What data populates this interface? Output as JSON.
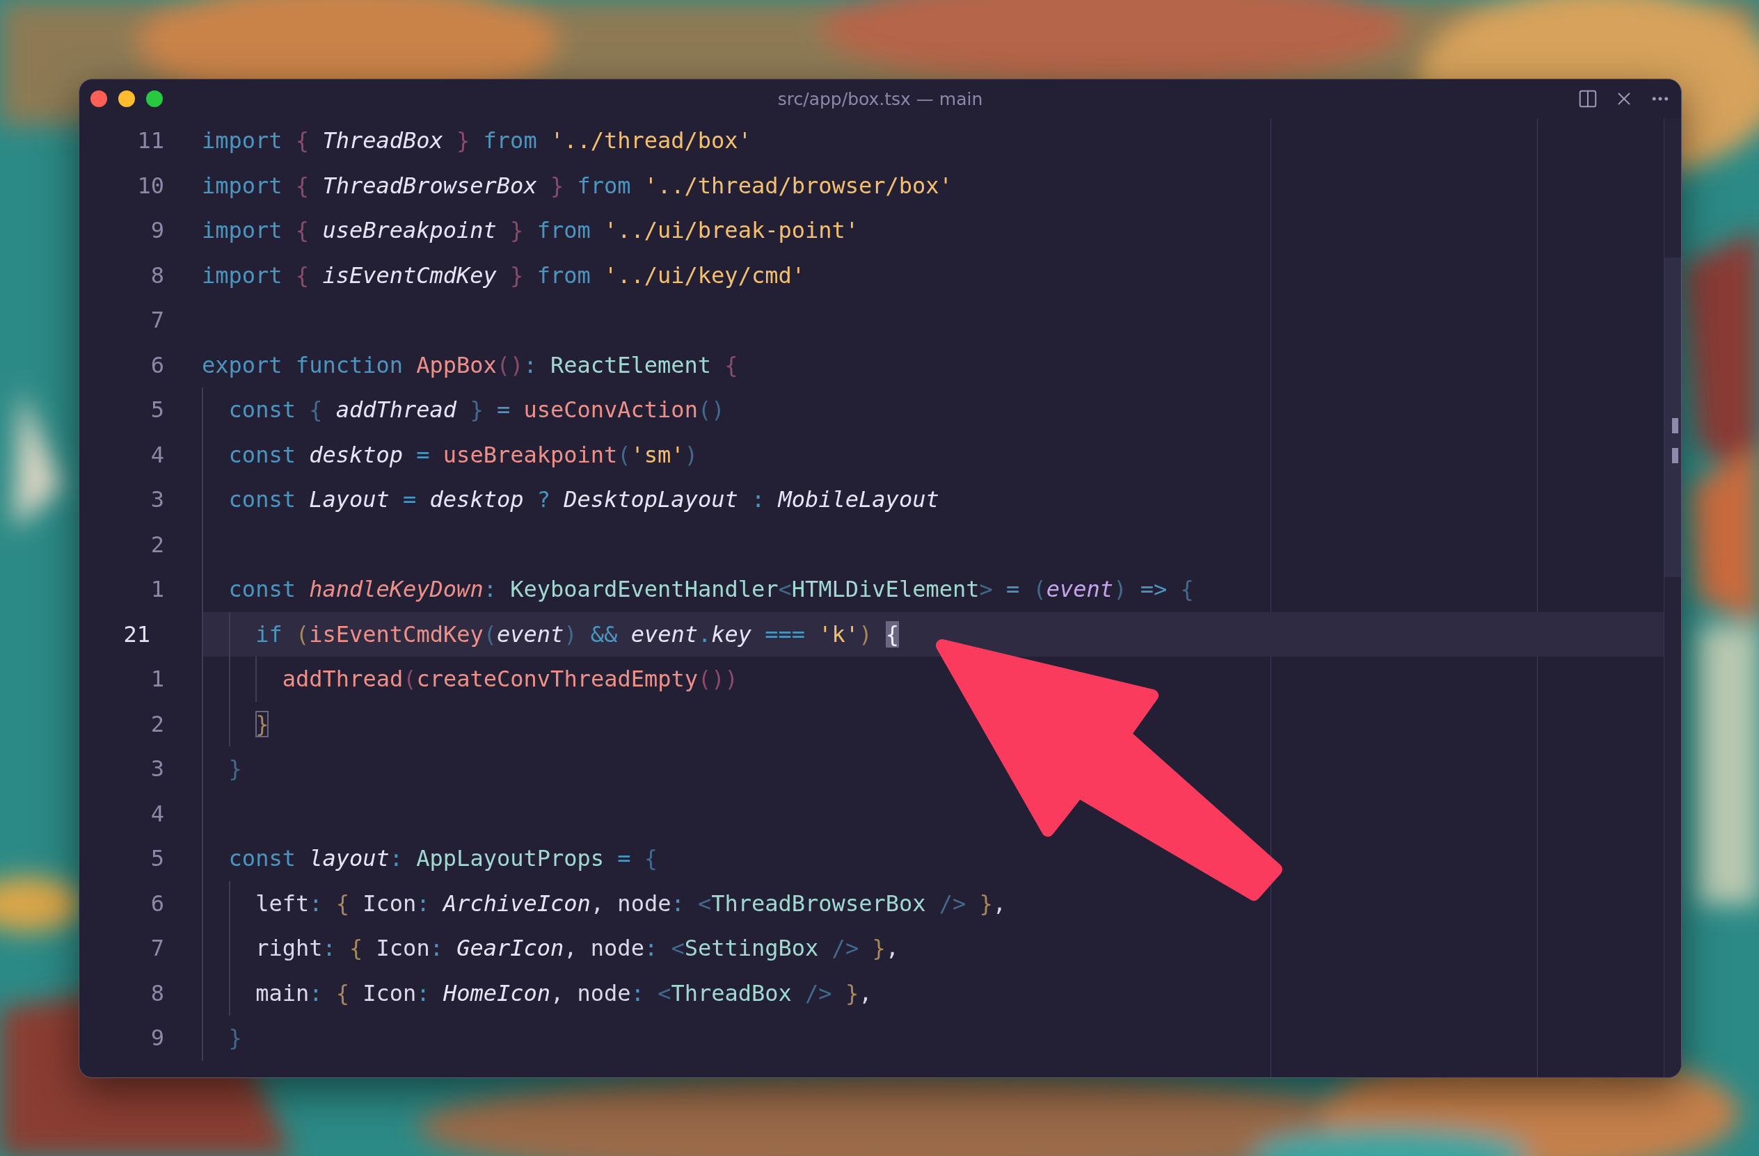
{
  "window": {
    "title": "src/app/box.tsx — main"
  },
  "editor": {
    "lines": [
      {
        "number": "11",
        "current": false,
        "bracket_match": false,
        "tokens": [
          {
            "text": "import ",
            "kind": "keyword"
          },
          {
            "text": "{ ",
            "kind": "bracket1"
          },
          {
            "text": "ThreadBox ",
            "kind": "italic"
          },
          {
            "text": "} ",
            "kind": "bracket1"
          },
          {
            "text": "from ",
            "kind": "keyword"
          },
          {
            "text": "'../thread/box'",
            "kind": "string"
          }
        ]
      },
      {
        "number": "10",
        "current": false,
        "bracket_match": false,
        "tokens": [
          {
            "text": "import ",
            "kind": "keyword"
          },
          {
            "text": "{ ",
            "kind": "bracket1"
          },
          {
            "text": "ThreadBrowserBox ",
            "kind": "italic"
          },
          {
            "text": "} ",
            "kind": "bracket1"
          },
          {
            "text": "from ",
            "kind": "keyword"
          },
          {
            "text": "'../thread/browser/box'",
            "kind": "string"
          }
        ]
      },
      {
        "number": "9",
        "current": false,
        "bracket_match": false,
        "tokens": [
          {
            "text": "import ",
            "kind": "keyword"
          },
          {
            "text": "{ ",
            "kind": "bracket1"
          },
          {
            "text": "useBreakpoint ",
            "kind": "italic"
          },
          {
            "text": "} ",
            "kind": "bracket1"
          },
          {
            "text": "from ",
            "kind": "keyword"
          },
          {
            "text": "'../ui/break-point'",
            "kind": "string"
          }
        ]
      },
      {
        "number": "8",
        "current": false,
        "bracket_match": false,
        "tokens": [
          {
            "text": "import ",
            "kind": "keyword"
          },
          {
            "text": "{ ",
            "kind": "bracket1"
          },
          {
            "text": "isEventCmdKey ",
            "kind": "italic"
          },
          {
            "text": "} ",
            "kind": "bracket1"
          },
          {
            "text": "from ",
            "kind": "keyword"
          },
          {
            "text": "'../ui/key/cmd'",
            "kind": "string"
          }
        ]
      },
      {
        "number": "7",
        "current": false
      },
      {
        "number": "6",
        "current": false,
        "bracket_match": false,
        "tokens": [
          {
            "text": "export function ",
            "kind": "keyword"
          },
          {
            "text": "AppBox",
            "kind": "function"
          },
          {
            "text": "()",
            "kind": "bracket1"
          },
          {
            "text": ": ",
            "kind": "operator"
          },
          {
            "text": "ReactElement ",
            "kind": "type"
          },
          {
            "text": "{",
            "kind": "bracket1"
          }
        ],
        "children": [
          {
            "number": "5",
            "current": false,
            "bracket_match": false,
            "tokens": [
              {
                "text": "const ",
                "kind": "keyword"
              },
              {
                "text": "{ ",
                "kind": "bracket2"
              },
              {
                "text": "addThread ",
                "kind": "italic"
              },
              {
                "text": "} ",
                "kind": "bracket2"
              },
              {
                "text": "= ",
                "kind": "operator"
              },
              {
                "text": "useConvAction",
                "kind": "function"
              },
              {
                "text": "()",
                "kind": "bracket2"
              }
            ]
          },
          {
            "number": "4",
            "current": false,
            "bracket_match": false,
            "tokens": [
              {
                "text": "const ",
                "kind": "keyword"
              },
              {
                "text": "desktop ",
                "kind": "italic"
              },
              {
                "text": "= ",
                "kind": "operator"
              },
              {
                "text": "useBreakpoint",
                "kind": "function"
              },
              {
                "text": "(",
                "kind": "bracket2"
              },
              {
                "text": "'sm'",
                "kind": "string"
              },
              {
                "text": ")",
                "kind": "bracket2"
              }
            ]
          },
          {
            "number": "3",
            "current": false,
            "bracket_match": false,
            "tokens": [
              {
                "text": "const ",
                "kind": "keyword"
              },
              {
                "text": "Layout ",
                "kind": "italic"
              },
              {
                "text": "= ",
                "kind": "operator"
              },
              {
                "text": "desktop ",
                "kind": "italic"
              },
              {
                "text": "? ",
                "kind": "operator"
              },
              {
                "text": "DesktopLayout ",
                "kind": "italic"
              },
              {
                "text": ": ",
                "kind": "operator"
              },
              {
                "text": "MobileLayout",
                "kind": "italic"
              }
            ]
          },
          {
            "number": "2",
            "current": false
          },
          {
            "number": "1",
            "current": false,
            "bracket_match": false,
            "tokens": [
              {
                "text": "const ",
                "kind": "keyword"
              },
              {
                "text": "handleKeyDown",
                "kind": "function_italic"
              },
              {
                "text": ": ",
                "kind": "operator"
              },
              {
                "text": "KeyboardEventHandler",
                "kind": "type"
              },
              {
                "text": "<",
                "kind": "bracket2"
              },
              {
                "text": "HTMLDivElement",
                "kind": "type"
              },
              {
                "text": "> ",
                "kind": "bracket2"
              },
              {
                "text": "= ",
                "kind": "operator"
              },
              {
                "text": "(",
                "kind": "bracket2"
              },
              {
                "text": "event",
                "kind": "parameter"
              },
              {
                "text": ") ",
                "kind": "bracket2"
              },
              {
                "text": "=> ",
                "kind": "operator"
              },
              {
                "text": "{",
                "kind": "bracket2"
              }
            ],
            "children": [
              {
                "number": "21",
                "current": true,
                "bracket_match": false,
                "tokens": [
                  {
                    "text": "if ",
                    "kind": "keyword"
                  },
                  {
                    "text": "(",
                    "kind": "bracket3"
                  },
                  {
                    "text": "isEventCmdKey",
                    "kind": "function"
                  },
                  {
                    "text": "(",
                    "kind": "bracket2"
                  },
                  {
                    "text": "event",
                    "kind": "italic"
                  },
                  {
                    "text": ") ",
                    "kind": "bracket2"
                  },
                  {
                    "text": "&& ",
                    "kind": "operator"
                  },
                  {
                    "text": "event",
                    "kind": "italic"
                  },
                  {
                    "text": ".",
                    "kind": "operator"
                  },
                  {
                    "text": "key ",
                    "kind": "italic"
                  },
                  {
                    "text": "=== ",
                    "kind": "operator"
                  },
                  {
                    "text": "'k'",
                    "kind": "string"
                  },
                  {
                    "text": ") ",
                    "kind": "bracket3"
                  },
                  {
                    "text": "{",
                    "kind": "plain"
                  }
                ],
                "children": [
                  {
                    "number": "1",
                    "current": false,
                    "bracket_match": false,
                    "tokens": [
                      {
                        "text": "addThread",
                        "kind": "function"
                      },
                      {
                        "text": "(",
                        "kind": "bracket1"
                      },
                      {
                        "text": "createConvThreadEmpty",
                        "kind": "function"
                      },
                      {
                        "text": "())",
                        "kind": "bracket1"
                      }
                    ]
                  }
                ]
              },
              {
                "number": "2",
                "current": false,
                "bracket_match": true,
                "tokens": [
                  {
                    "text": "}",
                    "kind": "bracket3"
                  }
                ]
              }
            ]
          },
          {
            "number": "3",
            "current": false,
            "bracket_match": false,
            "tokens": [
              {
                "text": "}",
                "kind": "bracket2"
              }
            ]
          },
          {
            "number": "4",
            "current": false
          },
          {
            "number": "5",
            "current": false,
            "bracket_match": false,
            "tokens": [
              {
                "text": "const ",
                "kind": "keyword"
              },
              {
                "text": "layout",
                "kind": "italic"
              },
              {
                "text": ": ",
                "kind": "operator"
              },
              {
                "text": "AppLayoutProps ",
                "kind": "type"
              },
              {
                "text": "= ",
                "kind": "operator"
              },
              {
                "text": "{",
                "kind": "bracket2"
              }
            ],
            "children": [
              {
                "number": "6",
                "current": false,
                "bracket_match": false,
                "tokens": [
                  {
                    "text": "left",
                    "kind": "plain"
                  },
                  {
                    "text": ": ",
                    "kind": "operator"
                  },
                  {
                    "text": "{ ",
                    "kind": "bracket3"
                  },
                  {
                    "text": "Icon",
                    "kind": "plain"
                  },
                  {
                    "text": ": ",
                    "kind": "operator"
                  },
                  {
                    "text": "ArchiveIcon",
                    "kind": "italic"
                  },
                  {
                    "text": ", node",
                    "kind": "plain"
                  },
                  {
                    "text": ": ",
                    "kind": "operator"
                  },
                  {
                    "text": "<",
                    "kind": "bracket2"
                  },
                  {
                    "text": "ThreadBrowserBox ",
                    "kind": "type"
                  },
                  {
                    "text": "/> ",
                    "kind": "bracket2"
                  },
                  {
                    "text": "}",
                    "kind": "bracket3"
                  },
                  {
                    "text": ",",
                    "kind": "plain"
                  }
                ]
              },
              {
                "number": "7",
                "current": false,
                "bracket_match": false,
                "tokens": [
                  {
                    "text": "right",
                    "kind": "plain"
                  },
                  {
                    "text": ": ",
                    "kind": "operator"
                  },
                  {
                    "text": "{ ",
                    "kind": "bracket3"
                  },
                  {
                    "text": "Icon",
                    "kind": "plain"
                  },
                  {
                    "text": ": ",
                    "kind": "operator"
                  },
                  {
                    "text": "GearIcon",
                    "kind": "italic"
                  },
                  {
                    "text": ", node",
                    "kind": "plain"
                  },
                  {
                    "text": ": ",
                    "kind": "operator"
                  },
                  {
                    "text": "<",
                    "kind": "bracket2"
                  },
                  {
                    "text": "SettingBox ",
                    "kind": "type"
                  },
                  {
                    "text": "/> ",
                    "kind": "bracket2"
                  },
                  {
                    "text": "}",
                    "kind": "bracket3"
                  },
                  {
                    "text": ",",
                    "kind": "plain"
                  }
                ]
              },
              {
                "number": "8",
                "current": false,
                "bracket_match": false,
                "tokens": [
                  {
                    "text": "main",
                    "kind": "plain"
                  },
                  {
                    "text": ": ",
                    "kind": "operator"
                  },
                  {
                    "text": "{ ",
                    "kind": "bracket3"
                  },
                  {
                    "text": "Icon",
                    "kind": "plain"
                  },
                  {
                    "text": ": ",
                    "kind": "operator"
                  },
                  {
                    "text": "HomeIcon",
                    "kind": "italic"
                  },
                  {
                    "text": ", node",
                    "kind": "plain"
                  },
                  {
                    "text": ": ",
                    "kind": "operator"
                  },
                  {
                    "text": "<",
                    "kind": "bracket2"
                  },
                  {
                    "text": "ThreadBox ",
                    "kind": "type"
                  },
                  {
                    "text": "/> ",
                    "kind": "bracket2"
                  },
                  {
                    "text": "}",
                    "kind": "bracket3"
                  },
                  {
                    "text": ",",
                    "kind": "plain"
                  }
                ]
              }
            ]
          },
          {
            "number": "9",
            "current": false,
            "bracket_match": false,
            "tokens": [
              {
                "text": "}",
                "kind": "bracket2"
              }
            ]
          }
        ]
      }
    ]
  }
}
